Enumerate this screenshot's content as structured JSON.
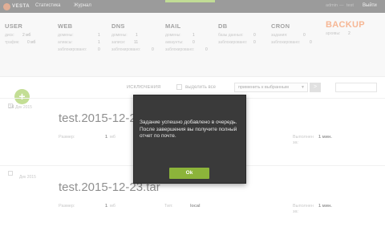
{
  "nav": {
    "logo_text": "VESTA",
    "links": [
      "Статистика",
      "Журнал"
    ],
    "user": "admin",
    "separator": "—",
    "user_sub": "test",
    "logout": "Выйти"
  },
  "stats": {
    "user": {
      "title": "USER",
      "rows": [
        {
          "label": "диск:",
          "value": "2 мб"
        },
        {
          "label": "трафик:",
          "value": "0 мб"
        }
      ]
    },
    "web": {
      "title": "WEB",
      "rows": [
        {
          "label": "домены:",
          "value": "1"
        },
        {
          "label": "алиасы:",
          "value": "1"
        },
        {
          "label": "заблокировано:",
          "value": "0"
        }
      ]
    },
    "dns": {
      "title": "DNS",
      "rows": [
        {
          "label": "домены:",
          "value": "1"
        },
        {
          "label": "записи:",
          "value": "11"
        },
        {
          "label": "заблокировано:",
          "value": "0"
        }
      ]
    },
    "mail": {
      "title": "MAIL",
      "rows": [
        {
          "label": "домены:",
          "value": "1"
        },
        {
          "label": "аккаунты:",
          "value": "0"
        },
        {
          "label": "заблокировано:",
          "value": "0"
        }
      ]
    },
    "db": {
      "title": "DB",
      "rows": [
        {
          "label": "базы данных:",
          "value": "0"
        },
        {
          "label": "заблокировано:",
          "value": "0"
        }
      ]
    },
    "cron": {
      "title": "CRON",
      "rows": [
        {
          "label": "задания:",
          "value": "0"
        },
        {
          "label": "заблокировано:",
          "value": "0"
        }
      ]
    },
    "backup": {
      "title": "BACKUP",
      "rows": [
        {
          "label": "архивы:",
          "value": "2"
        }
      ]
    }
  },
  "toolbar": {
    "add_label": "+",
    "exclusions": "ИСКЛЮЧЕНИЯ",
    "select_all": "выделить все",
    "apply_select": "применить к выбранным",
    "go": ">"
  },
  "rows": [
    {
      "day": "24",
      "date": "Дек 2015",
      "title": "test.2015-12-2",
      "size_label": "Размер:",
      "size_value": "1",
      "size_unit": "мб",
      "time_label": "Выполнен за:",
      "time_value": "1 мин."
    },
    {
      "day": "",
      "date": "Дек 2015",
      "title": "test.2015-12-23.tar",
      "size_label": "Размер:",
      "size_value": "1",
      "size_unit": "мб",
      "type_label": "Тип:",
      "type_value": "local",
      "time_label": "Выполнен за:",
      "time_value": "1 мин."
    }
  ],
  "modal": {
    "message": "Задание успешно добавлено в очередь. После завершения вы получите полный отчет по почте.",
    "ok": "Ok"
  },
  "colors": {
    "accent_orange": "#ef7d3f",
    "accent_green": "#8cb43a",
    "topbar": "#4a4a4a",
    "modal_bg": "#3a3a3a"
  }
}
